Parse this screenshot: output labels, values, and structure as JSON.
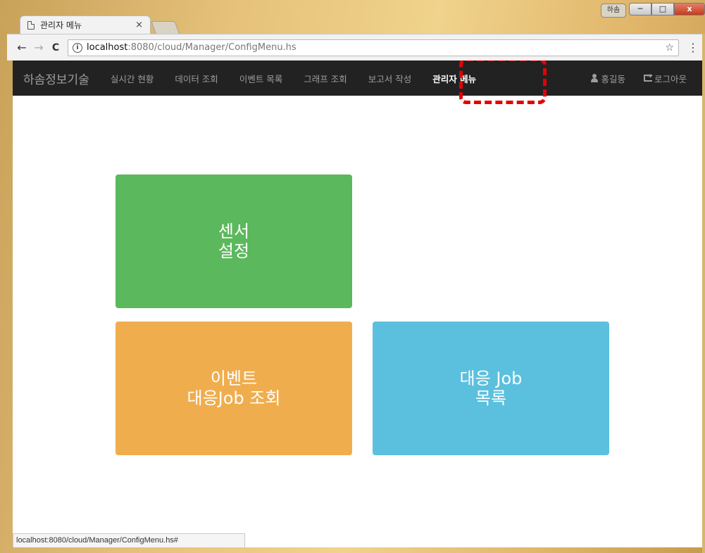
{
  "browser": {
    "tab_title": "관리자 메뉴",
    "tab_close": "×",
    "user_button": "하솜",
    "win_min": "─",
    "win_max": "□",
    "win_close": "x",
    "back": "←",
    "forward": "→",
    "reload": "C",
    "url_host": "localhost",
    "url_path": ":8080/cloud/Manager/ConfigMenu.hs",
    "info": "i",
    "star": "☆",
    "menu": "⋮",
    "status_text": "localhost:8080/cloud/Manager/ConfigMenu.hs#"
  },
  "navbar": {
    "brand": "하솜정보기술",
    "items": [
      {
        "label": "실시간 현황"
      },
      {
        "label": "데이터 조회"
      },
      {
        "label": "이벤트 목록"
      },
      {
        "label": "그래프 조회"
      },
      {
        "label": "보고서 작성"
      },
      {
        "label": "관리자 메뉴",
        "active": true
      }
    ],
    "user": "홍길동",
    "logout": "로그아웃"
  },
  "tiles": [
    {
      "label": "센서\n설정",
      "color": "#5cb85c"
    },
    {
      "label": "이벤트\n대응Job 조회",
      "color": "#f0ad4e"
    },
    {
      "label": "대응 Job\n목록",
      "color": "#5bc0de"
    }
  ],
  "colors": {
    "navbar_bg": "#222222",
    "highlight": "#e60000"
  }
}
